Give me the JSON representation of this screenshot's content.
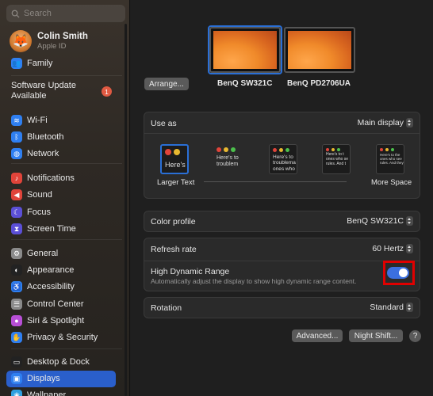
{
  "sidebar": {
    "search_placeholder": "Search",
    "profile": {
      "name": "Colin Smith",
      "subtitle": "Apple ID"
    },
    "family": "Family",
    "update": {
      "label_line1": "Software Update",
      "label_line2": "Available",
      "badge": "1"
    },
    "items": [
      {
        "label": "Wi-Fi",
        "icon": "wifi-icon",
        "color": "#2f7ff0"
      },
      {
        "label": "Bluetooth",
        "icon": "bluetooth-icon",
        "color": "#2f7ff0"
      },
      {
        "label": "Network",
        "icon": "globe-icon",
        "color": "#2f7ff0"
      },
      {
        "label": "Notifications",
        "icon": "bell-icon",
        "color": "#e0443a"
      },
      {
        "label": "Sound",
        "icon": "speaker-icon",
        "color": "#e0443a"
      },
      {
        "label": "Focus",
        "icon": "moon-icon",
        "color": "#5b4fd6"
      },
      {
        "label": "Screen Time",
        "icon": "hourglass-icon",
        "color": "#5b4fd6"
      },
      {
        "label": "General",
        "icon": "gear-icon",
        "color": "#8a8a8a"
      },
      {
        "label": "Appearance",
        "icon": "appearance-icon",
        "color": "#222222"
      },
      {
        "label": "Accessibility",
        "icon": "accessibility-icon",
        "color": "#2f7ff0"
      },
      {
        "label": "Control Center",
        "icon": "control-center-icon",
        "color": "#8a8a8a"
      },
      {
        "label": "Siri & Spotlight",
        "icon": "siri-icon",
        "color": "#b84fd6"
      },
      {
        "label": "Privacy & Security",
        "icon": "hand-icon",
        "color": "#2f7ff0"
      },
      {
        "label": "Desktop & Dock",
        "icon": "dock-icon",
        "color": "#222222"
      },
      {
        "label": "Displays",
        "icon": "display-icon",
        "color": "#2f7ff0"
      },
      {
        "label": "Wallpaper",
        "icon": "wallpaper-icon",
        "color": "#2fa0e0"
      }
    ]
  },
  "main": {
    "arrange_label": "Arrange...",
    "displays": [
      "BenQ SW321C",
      "BenQ PD2706UA"
    ],
    "use_as": {
      "label": "Use as",
      "value": "Main display"
    },
    "resolution": {
      "left_label": "Larger Text",
      "right_label": "More Space",
      "preview_text": "Here's",
      "snippets": [
        "Here's to\ntroublem",
        "Here's to\ntroublema\nones who",
        "Here's to t\nones who se\nrules. And t",
        "Here's to the\nones who see\nrules. And they"
      ]
    },
    "color_profile": {
      "label": "Color profile",
      "value": "BenQ SW321C"
    },
    "refresh_rate": {
      "label": "Refresh rate",
      "value": "60 Hertz"
    },
    "hdr": {
      "label": "High Dynamic Range",
      "description": "Automatically adjust the display to show high dynamic range content.",
      "enabled": true
    },
    "rotation": {
      "label": "Rotation",
      "value": "Standard"
    },
    "buttons": {
      "advanced": "Advanced...",
      "night_shift": "Night Shift...",
      "help": "?"
    }
  }
}
